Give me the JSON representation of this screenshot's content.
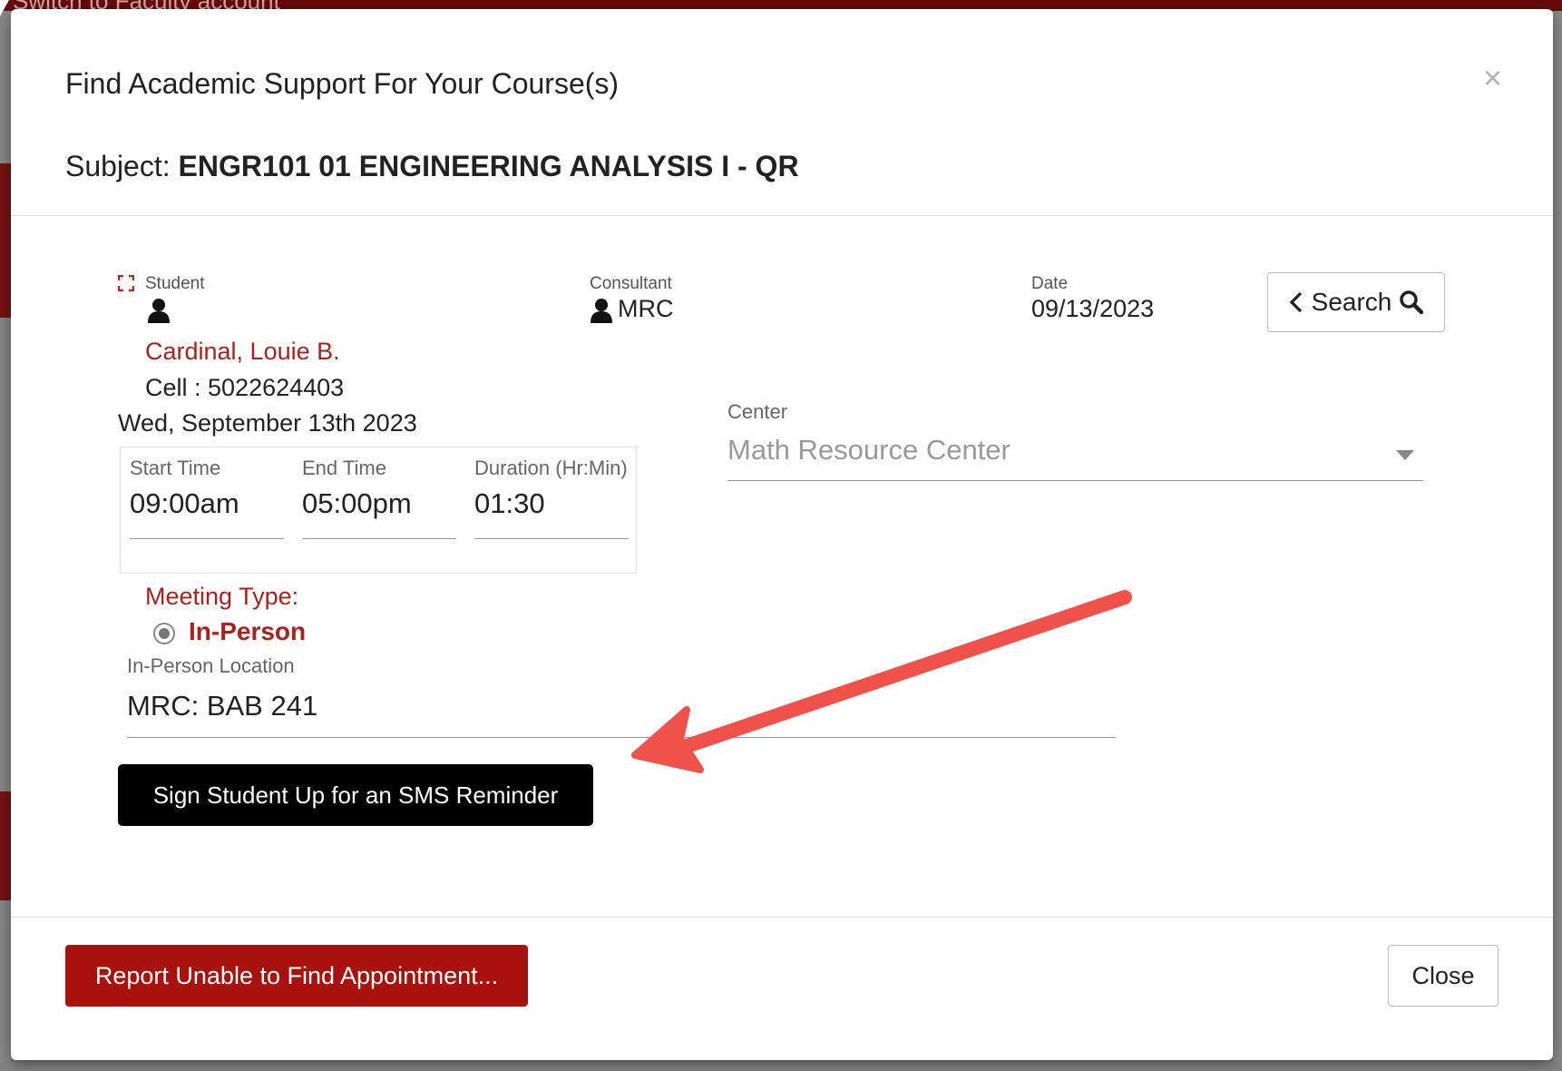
{
  "background": {
    "top_text": "Switch to Faculty account"
  },
  "modal": {
    "title": "Find Academic Support For Your Course(s)",
    "close_glyph": "×",
    "subject_label": "Subject: ",
    "subject_value": "ENGR101 01 ENGINEERING ANALYSIS I - QR"
  },
  "student": {
    "label": "Student",
    "name": "Cardinal, Louie B.",
    "cell": "Cell : 5022624403",
    "date_long": "Wed, September 13th 2023"
  },
  "consultant": {
    "label": "Consultant",
    "value": "MRC"
  },
  "date": {
    "label": "Date",
    "value": "09/13/2023"
  },
  "search_button": {
    "label": "Search"
  },
  "times": {
    "start_label": "Start Time",
    "start_value": "09:00am",
    "end_label": "End Time",
    "end_value": "05:00pm",
    "duration_label": "Duration (Hr:Min)",
    "duration_value": "01:30"
  },
  "center": {
    "label": "Center",
    "value": "Math Resource Center"
  },
  "meeting": {
    "label": "Meeting Type:",
    "option": "In-Person",
    "location_label": "In-Person Location",
    "location_value": "MRC: BAB 241"
  },
  "sms_button": {
    "label": "Sign Student Up for an SMS Reminder"
  },
  "footer": {
    "report_label": "Report Unable to Find Appointment...",
    "close_label": "Close"
  },
  "colors": {
    "brand_red": "#a8110c",
    "label_red": "#a8231c",
    "annotation_arrow": "#f0524a"
  },
  "icons": [
    "focus-icon",
    "person-icon",
    "chevron-left-icon",
    "search-icon",
    "close-icon",
    "caret-down-icon",
    "annotation-arrow"
  ]
}
